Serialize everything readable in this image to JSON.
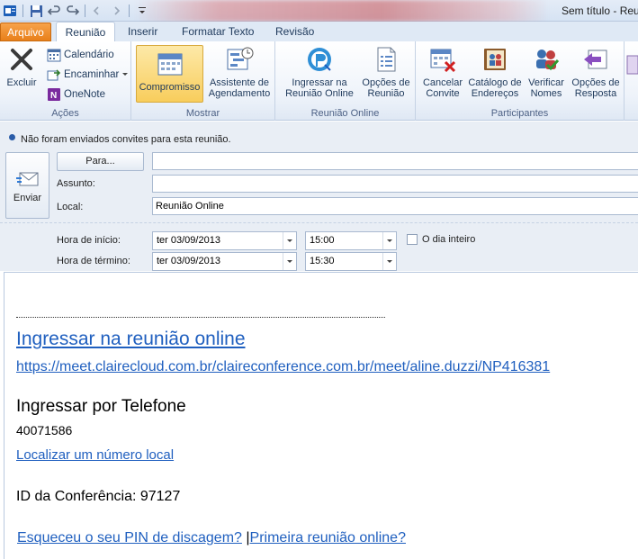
{
  "window": {
    "title": "Sem título - Reu"
  },
  "tabs": [
    {
      "label": "Arquivo"
    },
    {
      "label": "Reunião"
    },
    {
      "label": "Inserir"
    },
    {
      "label": "Formatar Texto"
    },
    {
      "label": "Revisão"
    }
  ],
  "ribbon": {
    "acoes": {
      "label": "Ações",
      "excluir": "Excluir",
      "calendario": "Calendário",
      "encaminhar": "Encaminhar",
      "onenote": "OneNote"
    },
    "mostrar": {
      "label": "Mostrar",
      "compromisso": "Compromisso",
      "assistente_line1": "Assistente de",
      "assistente_line2": "Agendamento"
    },
    "reuniao_online": {
      "label": "Reunião Online",
      "ingressar_line1": "Ingressar na",
      "ingressar_line2": "Reunião Online",
      "opcoes_line1": "Opções de",
      "opcoes_line2": "Reunião"
    },
    "participantes": {
      "label": "Participantes",
      "cancelar_line1": "Cancelar",
      "cancelar_line2": "Convite",
      "catalogo_line1": "Catálogo de",
      "catalogo_line2": "Endereços",
      "verificar_line1": "Verificar",
      "verificar_line2": "Nomes",
      "opcoes_line1": "Opções de",
      "opcoes_line2": "Resposta"
    }
  },
  "infobar": {
    "text": "Não foram enviados convites para esta reunião."
  },
  "form": {
    "send_label": "Enviar",
    "to_button": "Para...",
    "to_value": "",
    "subject_label": "Assunto:",
    "subject_value": "",
    "location_label": "Local:",
    "location_value": "Reunião Online",
    "start_label": "Hora de início:",
    "start_date": "ter 03/09/2013",
    "start_time": "15:00",
    "end_label": "Hora de término:",
    "end_date": "ter 03/09/2013",
    "end_time": "15:30",
    "all_day_label": "O dia inteiro",
    "all_day_checked": false
  },
  "body": {
    "join_link": "Ingressar na reunião online",
    "join_url": "https://meet.clairecloud.com.br/claireconference.com.br/meet/aline.duzzi/NP416381",
    "phone_heading": "Ingressar por Telefone",
    "phone_number": "40071586",
    "local_number_link": "Localizar um número local",
    "conference_id": "ID da Conferência: 97127",
    "forgot_pin_link": "Esqueceu o seu PIN de discagem?",
    "separator": "|",
    "first_meeting_link": "Primeira reunião online?"
  }
}
